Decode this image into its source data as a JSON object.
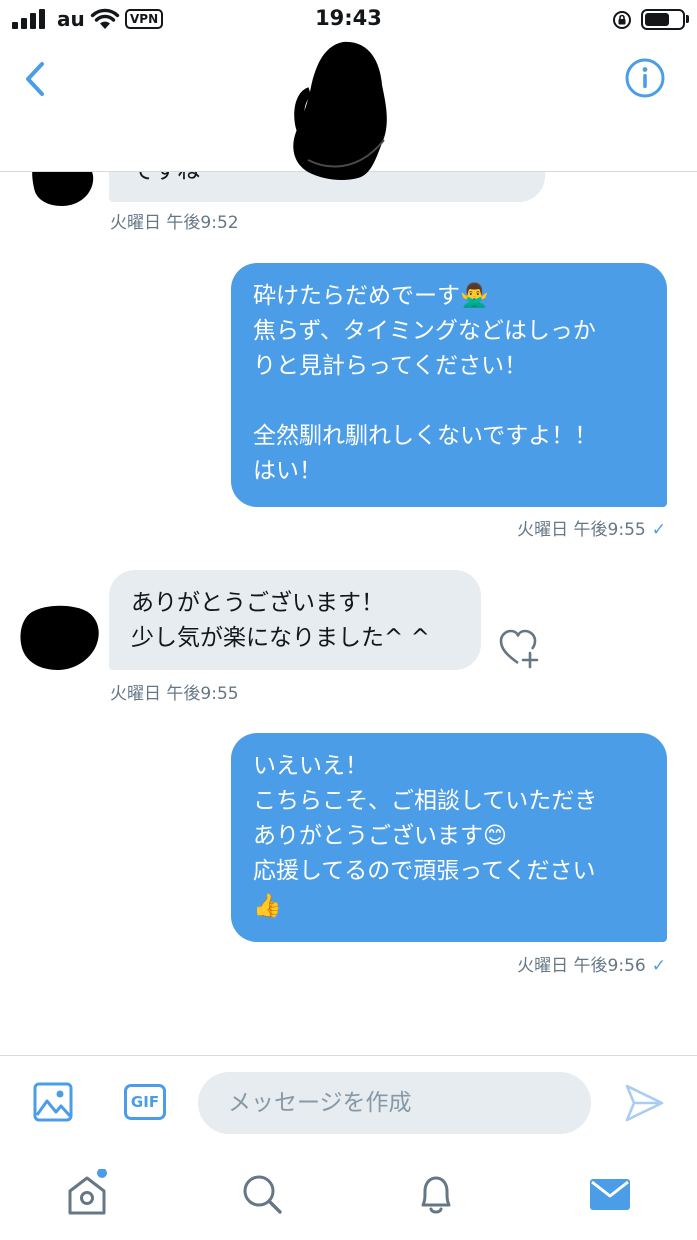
{
  "status_bar": {
    "carrier": "au",
    "vpn": "VPN",
    "time": "19:43"
  },
  "header": {
    "back_icon": "chevron-left-icon",
    "info_icon": "info-circle-icon"
  },
  "messages": [
    {
      "direction": "incoming",
      "text": "ですね",
      "time": "火曜日 午後9:52"
    },
    {
      "direction": "outgoing",
      "text": "砕けたらだめでーす🙅‍♂️\n焦らず、タイミングなどはしっか\nりと見計らってください！\n\n全然馴れ馴れしくないですよ！！\nはい！",
      "time": "火曜日 午後9:55",
      "read_mark": "✓"
    },
    {
      "direction": "incoming",
      "text": "ありがとうございます！\n少し気が楽になりました^ ^",
      "time": "火曜日 午後9:55"
    },
    {
      "direction": "outgoing",
      "text": "いえいえ！\nこちらこそ、ご相談していただき\nありがとうございます😊\n応援してるので頑張ってください\n👍",
      "time": "火曜日 午後9:56",
      "read_mark": "✓"
    }
  ],
  "compose": {
    "placeholder": "メッセージを作成",
    "gif_label": "GIF"
  },
  "tab_bar": {
    "tabs": [
      "home-icon",
      "search-icon",
      "notifications-bell-icon",
      "messages-envelope-icon"
    ],
    "active_tab": "messages-envelope-icon",
    "home_has_notification_dot": true
  },
  "colors": {
    "accent": "#4c9de8",
    "incoming_bubble": "#e6ecf0",
    "secondary_text": "#657786"
  }
}
